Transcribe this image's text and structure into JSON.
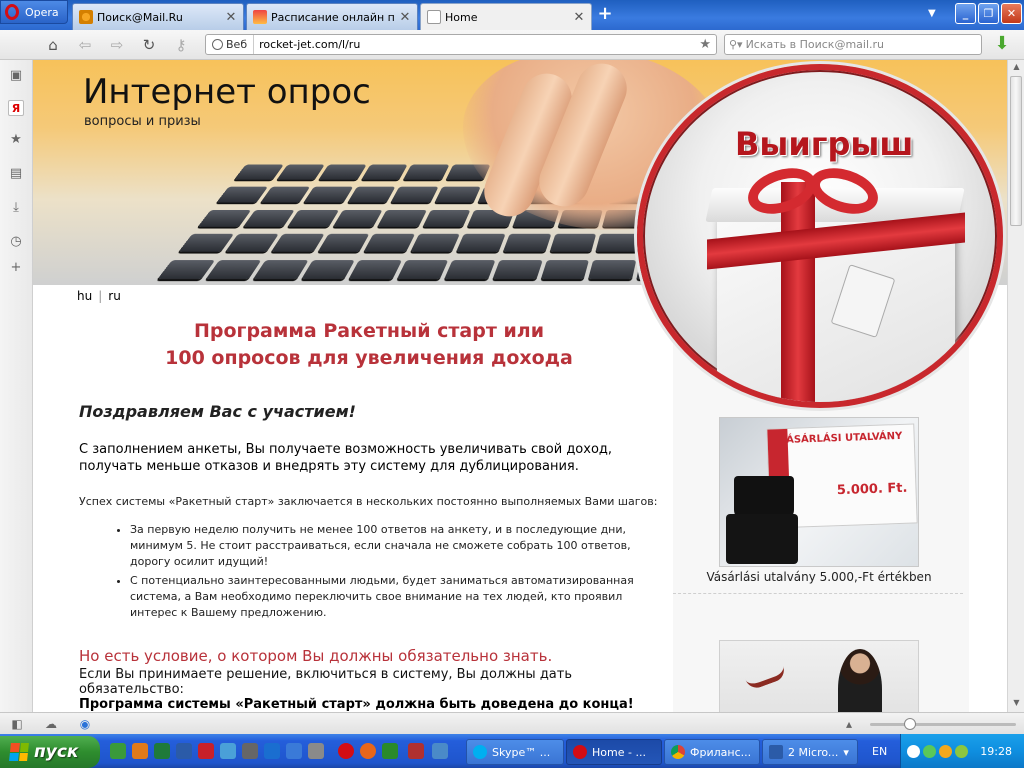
{
  "browser": {
    "menu_label": "Opera",
    "tabs": [
      {
        "title": "Поиск@Mail.Ru",
        "active": false
      },
      {
        "title": "Расписание онлайн пре...",
        "active": false
      },
      {
        "title": "Home",
        "active": true
      }
    ],
    "address": {
      "web_label": "Веб",
      "url": "rocket-jet.com/l/ru"
    },
    "search_placeholder": "Искать в Поиск@mail.ru"
  },
  "page": {
    "site_title": "Интернет опрос",
    "site_subtitle": "вопросы и призы",
    "badge_text": "Выигрыш",
    "languages": [
      "hu",
      "ru"
    ],
    "headline_line1": "Программа Ракетный старт или",
    "headline_line2": "100 опросов для увеличения дохода",
    "congrats": "Поздравляем Вас с участием!",
    "lead": "С заполнением  анкеты, Вы получаете возможность увеличивать свой доход, получать меньше отказов и внедрять эту систему для дублицирования.",
    "para": "Успех системы «Ракетный старт» заключается в нескольких постоянно выполняемых Вами шагов:",
    "bullets": [
      "За первую неделю получить не менее 100 ответов на анкету, и в последующие дни, минимум 5.  Не стоит расстраиваться, если сначала не сможете собрать 100 ответов, дорогу осилит идущий!",
      "С потенциально заинтересованными людьми, будет заниматься автоматизированная система, а Вам необходимо переключить свое внимание на тех людей, кто проявил интерес к Вашему предложению."
    ],
    "condition_title": "Но есть условие, о котором Вы должны обязательно знать.",
    "condition_text": "Если Вы принимаете решение,  включиться в систему, Вы должны дать обязательство:",
    "condition_bold": "Программа системы «Ракетный старт» должна быть доведена до конца!",
    "prize1": {
      "voucher_title": "VÁSÁRLÁSI UTALVÁNY",
      "voucher_amount": "5.000. Ft.",
      "caption": "Vásárlási utalvány 5.000,-Ft értékben"
    }
  },
  "taskbar": {
    "start_label": "пуск",
    "tasks": [
      {
        "label": "Skype™ ...",
        "active": false
      },
      {
        "label": "Home - ...",
        "active": true
      },
      {
        "label": "Фриланс...",
        "active": false
      },
      {
        "label": "2 Micro...",
        "active": false
      }
    ],
    "lang": "EN",
    "clock": "19:28"
  },
  "colors": {
    "accent_red": "#b8323a",
    "xp_blue": "#245edb",
    "start_green": "#2e8d2e"
  }
}
